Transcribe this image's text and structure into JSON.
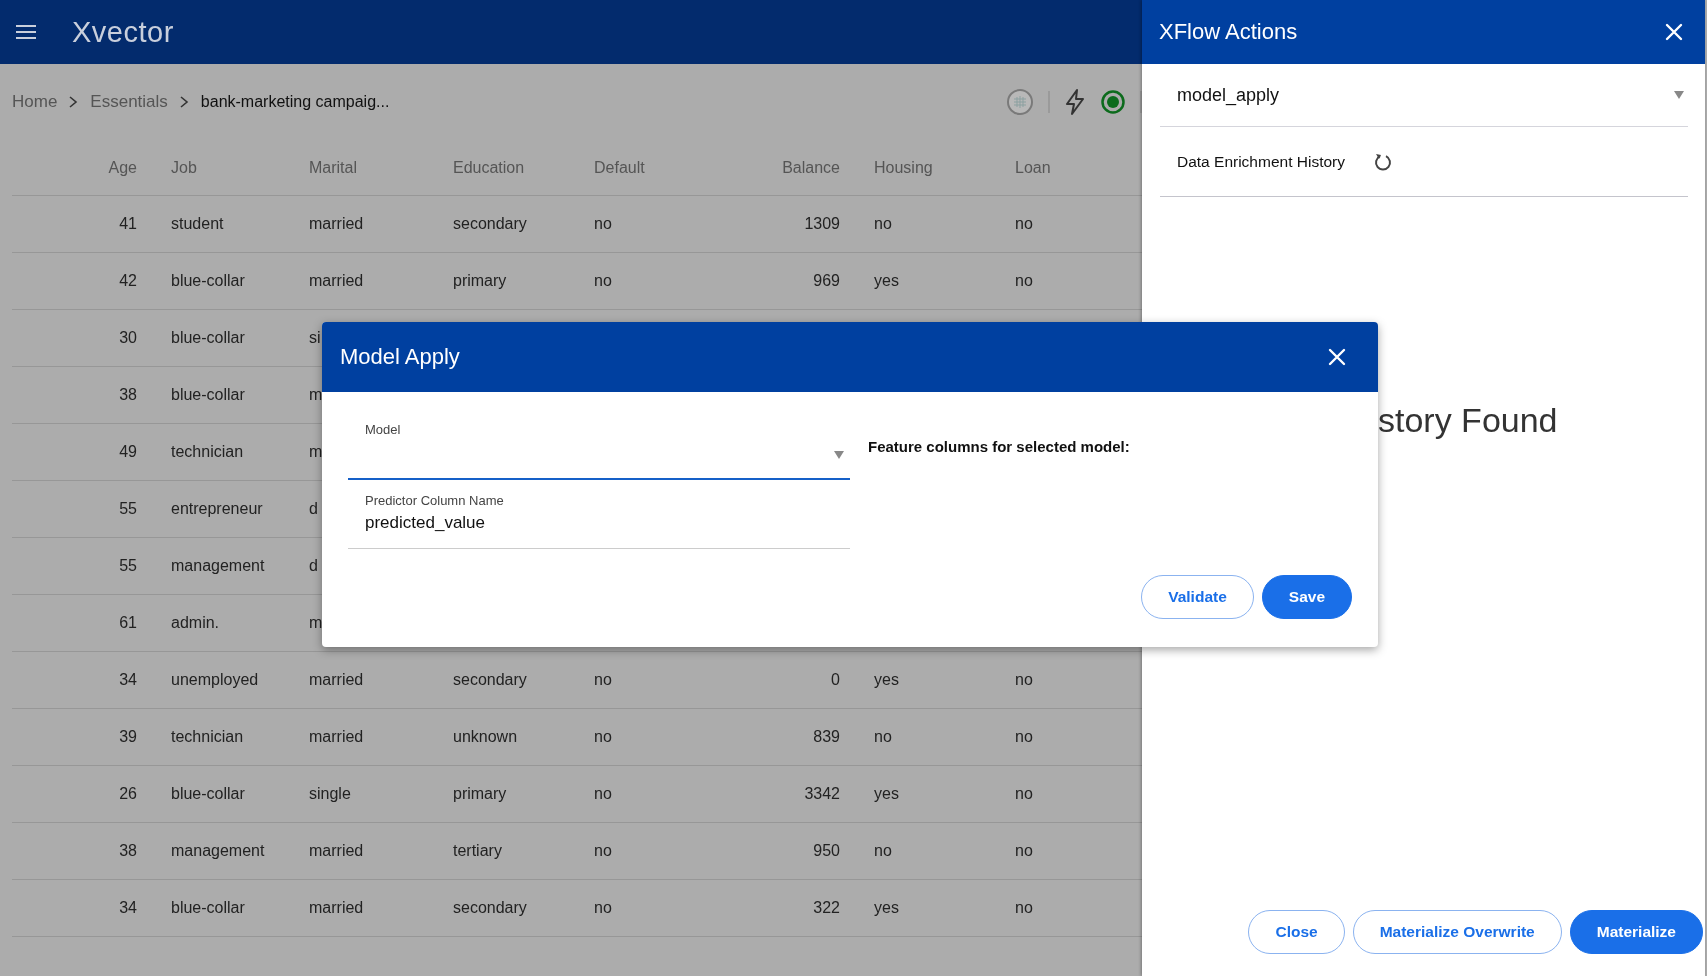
{
  "app": {
    "title": "Xvector"
  },
  "breadcrumb": [
    {
      "label": "Home"
    },
    {
      "label": "Essentials"
    },
    {
      "label": "bank-marketing campaig..."
    }
  ],
  "table": {
    "columns": [
      "Age",
      "Job",
      "Marital",
      "Education",
      "Default",
      "Balance",
      "Housing",
      "Loan"
    ],
    "rows": [
      [
        "41",
        "student",
        "married",
        "secondary",
        "no",
        "1309",
        "no",
        "no"
      ],
      [
        "42",
        "blue-collar",
        "married",
        "primary",
        "no",
        "969",
        "yes",
        "no"
      ],
      [
        "30",
        "blue-collar",
        "si"
      ],
      [
        "38",
        "blue-collar",
        "m"
      ],
      [
        "49",
        "technician",
        "m"
      ],
      [
        "55",
        "entrepreneur",
        "d"
      ],
      [
        "55",
        "management",
        "d"
      ],
      [
        "61",
        "admin.",
        "m"
      ],
      [
        "34",
        "unemployed",
        "married",
        "secondary",
        "no",
        "0",
        "yes",
        "no"
      ],
      [
        "39",
        "technician",
        "married",
        "unknown",
        "no",
        "839",
        "no",
        "no"
      ],
      [
        "26",
        "blue-collar",
        "single",
        "primary",
        "no",
        "3342",
        "yes",
        "no"
      ],
      [
        "38",
        "management",
        "married",
        "tertiary",
        "no",
        "950",
        "no",
        "no"
      ],
      [
        "34",
        "blue-collar",
        "married",
        "secondary",
        "no",
        "322",
        "yes",
        "no"
      ]
    ]
  },
  "panel": {
    "title": "XFlow Actions",
    "action_select": {
      "value": "model_apply"
    },
    "history_label": "Data Enrichment History",
    "empty_message": "story Found",
    "buttons": [
      {
        "label": "Close",
        "kind": "outline"
      },
      {
        "label": "Materialize Overwrite",
        "kind": "outline"
      },
      {
        "label": "Materialize",
        "kind": "primary"
      }
    ]
  },
  "dialog": {
    "title": "Model Apply",
    "model_field": {
      "label": "Model",
      "focused": true
    },
    "predictor_field": {
      "label": "Predictor Column Name",
      "value": "predicted_value"
    },
    "feature_heading": "Feature columns for selected model:",
    "buttons": [
      {
        "label": "Validate",
        "kind": "outline"
      },
      {
        "label": "Save",
        "kind": "primary"
      }
    ]
  }
}
